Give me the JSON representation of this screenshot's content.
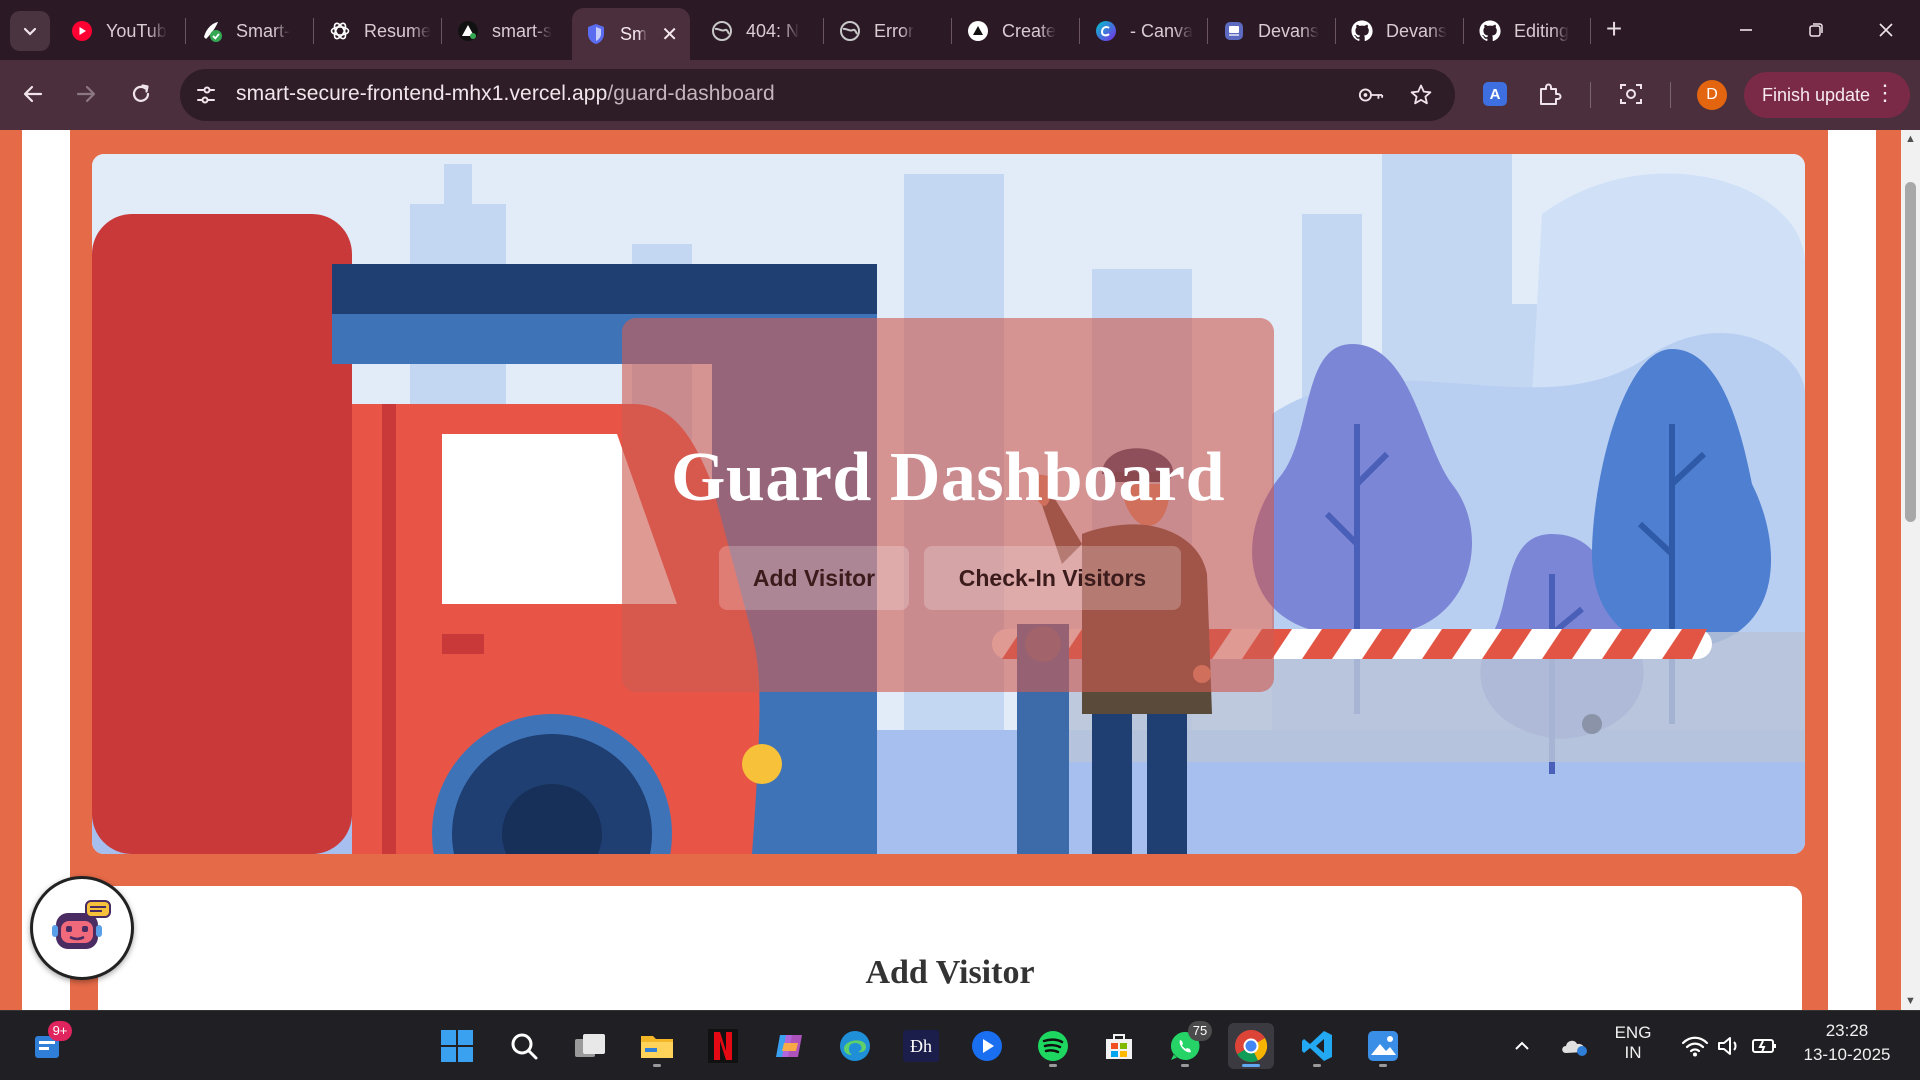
{
  "tabs": [
    {
      "title": "YouTub",
      "icon": "youtube-icon",
      "color": "#ff0033"
    },
    {
      "title": "Smart-",
      "icon": "smart-check-icon",
      "color": "#34a853"
    },
    {
      "title": "Resume",
      "icon": "openai-icon",
      "color": "#ffffff"
    },
    {
      "title": "smart-s",
      "icon": "triangle-icon",
      "color": "#ffffff"
    },
    {
      "title": "Sm",
      "icon": "shield-icon",
      "color": "#5a6cf0",
      "active": true
    },
    {
      "title": "404: N",
      "icon": "globe-icon",
      "color": "#c8c8c8"
    },
    {
      "title": "Error",
      "icon": "globe-icon",
      "color": "#c8c8c8"
    },
    {
      "title": "Create",
      "icon": "triangle-icon",
      "color": "#ffffff"
    },
    {
      "title": "- Canva",
      "icon": "canva-icon",
      "color": "#7d2ae8"
    },
    {
      "title": "Devans",
      "icon": "devans-icon",
      "color": "#5c6bc0"
    },
    {
      "title": "Devans",
      "icon": "github-icon",
      "color": "#ffffff"
    },
    {
      "title": "Editing",
      "icon": "github-icon",
      "color": "#ffffff"
    }
  ],
  "toolbar": {
    "url_host": "smart-secure-frontend-mhx1.vercel.app",
    "url_path": "/guard-dashboard",
    "profile_initial": "D",
    "finish_update": "Finish update"
  },
  "page": {
    "hero_title": "Guard Dashboard",
    "btn_add_visitor": "Add Visitor",
    "btn_checkin": "Check-In Visitors",
    "section_title": "Add Visitor"
  },
  "taskbar": {
    "widgets_badge": "9+",
    "whatsapp_badge": "75",
    "lang_top": "ENG",
    "lang_bottom": "IN",
    "time": "23:28",
    "date": "13-10-2025"
  },
  "colors": {
    "accent_orange": "#e56a48",
    "browser_frame": "#4b2f3c",
    "finish_update": "#7a2a46"
  }
}
